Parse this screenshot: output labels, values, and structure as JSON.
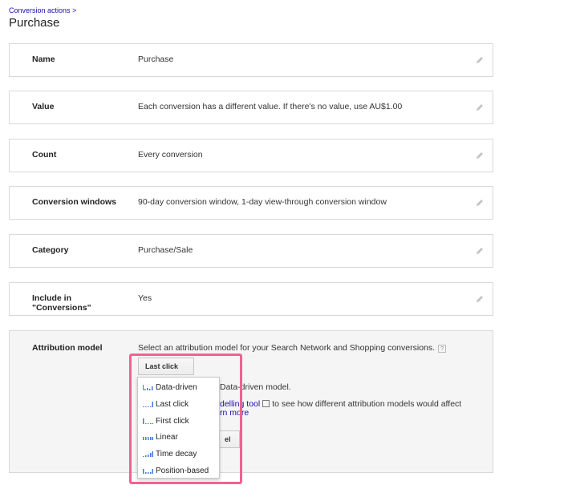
{
  "breadcrumb": {
    "parent": "Conversion actions",
    "separator": ">"
  },
  "page": {
    "title": "Purchase"
  },
  "rows": [
    {
      "label": "Name",
      "value": "Purchase"
    },
    {
      "label": "Value",
      "value": "Each conversion has a different value. If there's no value, use AU$1.00"
    },
    {
      "label": "Count",
      "value": "Every conversion"
    },
    {
      "label": "Conversion windows",
      "value": "90-day conversion window, 1-day view-through conversion window"
    },
    {
      "label": "Category",
      "value": "Purchase/Sale"
    },
    {
      "label": "Include in \"Conversions\"",
      "value": "Yes"
    }
  ],
  "attribution": {
    "label": "Attribution model",
    "prompt": "Select an attribution model for your Search Network and Shopping conversions.",
    "help": "?",
    "selected": "Last click",
    "bg_line1": "Data-driven model.",
    "bg_link": "delling tool",
    "bg_line2": "to see how different attribution models would affect",
    "bg_link2": "rn more",
    "bg_button": "el"
  },
  "menu": {
    "items": [
      {
        "label": "Data-driven",
        "icon": "data-driven-icon"
      },
      {
        "label": "Last click",
        "icon": "last-click-icon"
      },
      {
        "label": "First click",
        "icon": "first-click-icon"
      },
      {
        "label": "Linear",
        "icon": "linear-icon"
      },
      {
        "label": "Time decay",
        "icon": "time-decay-icon"
      },
      {
        "label": "Position-based",
        "icon": "position-based-icon"
      }
    ]
  },
  "colors": {
    "link": "#1a0dab",
    "highlight": "#f06292",
    "border": "#d9d9d9",
    "chart_blue": "#3b78e7"
  }
}
